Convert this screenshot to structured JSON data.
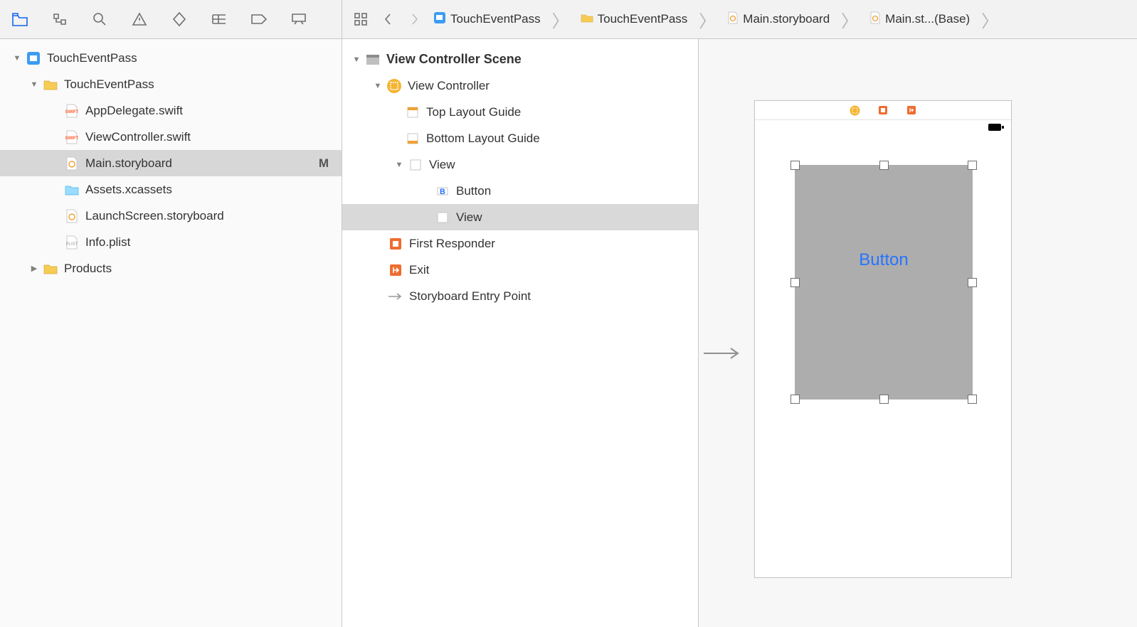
{
  "navigator": {
    "project": "TouchEventPass",
    "group": "TouchEventPass",
    "files": {
      "app_delegate": "AppDelegate.swift",
      "view_controller": "ViewController.swift",
      "main_storyboard": "Main.storyboard",
      "main_storyboard_status": "M",
      "assets": "Assets.xcassets",
      "launch_screen": "LaunchScreen.storyboard",
      "info_plist": "Info.plist"
    },
    "products": "Products"
  },
  "jumpbar": {
    "c1": "TouchEventPass",
    "c2": "TouchEventPass",
    "c3": "Main.storyboard",
    "c4": "Main.st...(Base)"
  },
  "outline": {
    "scene": "View Controller Scene",
    "view_controller": "View Controller",
    "top_guide": "Top Layout Guide",
    "bottom_guide": "Bottom Layout Guide",
    "view": "View",
    "button": "Button",
    "inner_view": "View",
    "first_responder": "First Responder",
    "exit": "Exit",
    "entry_point": "Storyboard Entry Point"
  },
  "canvas": {
    "button_label": "Button"
  }
}
